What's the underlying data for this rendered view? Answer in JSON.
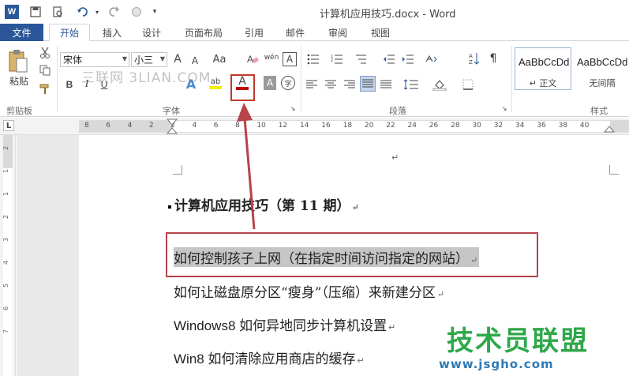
{
  "titlebar": {
    "app_icon": "W",
    "title": "计算机应用技巧.docx - Word",
    "qat_icons": [
      "save-icon",
      "print-preview-icon",
      "undo-icon",
      "redo-icon",
      "circle-icon",
      "customize-icon"
    ]
  },
  "tabs": {
    "file": "文件",
    "home": "开始",
    "insert": "插入",
    "design": "设计",
    "layout": "页面布局",
    "references": "引用",
    "mailings": "邮件",
    "review": "审阅",
    "view": "视图"
  },
  "clipboard": {
    "paste": "粘贴",
    "label": "剪贴板"
  },
  "font": {
    "font_name": "宋体",
    "font_size": "小三",
    "grow": "A",
    "shrink": "A",
    "change_case": "Aa",
    "phonetic": "wén",
    "char_border": "A",
    "bold": "B",
    "italic": "I",
    "underline": "U",
    "text_effect": "A",
    "highlight": "ab",
    "font_color": "A",
    "char_shade": "A",
    "enclose": "字",
    "label": "字体"
  },
  "paragraph": {
    "label": "段落"
  },
  "styles": {
    "items": [
      {
        "sample": "AaBbCcDd",
        "name": "↵ 正文"
      },
      {
        "sample": "AaBbCcDd",
        "name": "无间隔"
      }
    ],
    "label": "样式"
  },
  "ruler": {
    "ticks": [
      "8",
      "6",
      "4",
      "2",
      "2",
      "4",
      "6",
      "8",
      "10",
      "12",
      "14",
      "16",
      "18",
      "20",
      "22",
      "24",
      "26",
      "28",
      "30",
      "32",
      "34",
      "36",
      "38",
      "40"
    ],
    "vticks": [
      "2",
      "1",
      "1",
      "2",
      "3",
      "4",
      "5",
      "6",
      "7"
    ],
    "tab_stop": "L"
  },
  "document": {
    "paragraph_mark": "↵",
    "heading": "计算机应用技巧（第 11 期）",
    "lines": [
      "如何控制孩子上网（在指定时间访问指定的网站）",
      "如何让磁盘原分区“瘦身”（压缩）来新建分区",
      "Windows8 如何异地同步计算机设置",
      "Win8 如何清除应用商店的缓存"
    ]
  },
  "watermarks": {
    "top": "三联网 3LIAN.COM",
    "brand": "技术员联盟",
    "url": "www.jsgho.com"
  },
  "colors": {
    "word_blue": "#2b579a",
    "annotation_red": "#c0392b",
    "selection_gray": "#c6c6c6",
    "brand_green": "#2ea84a",
    "url_blue": "#2f7ab5"
  }
}
